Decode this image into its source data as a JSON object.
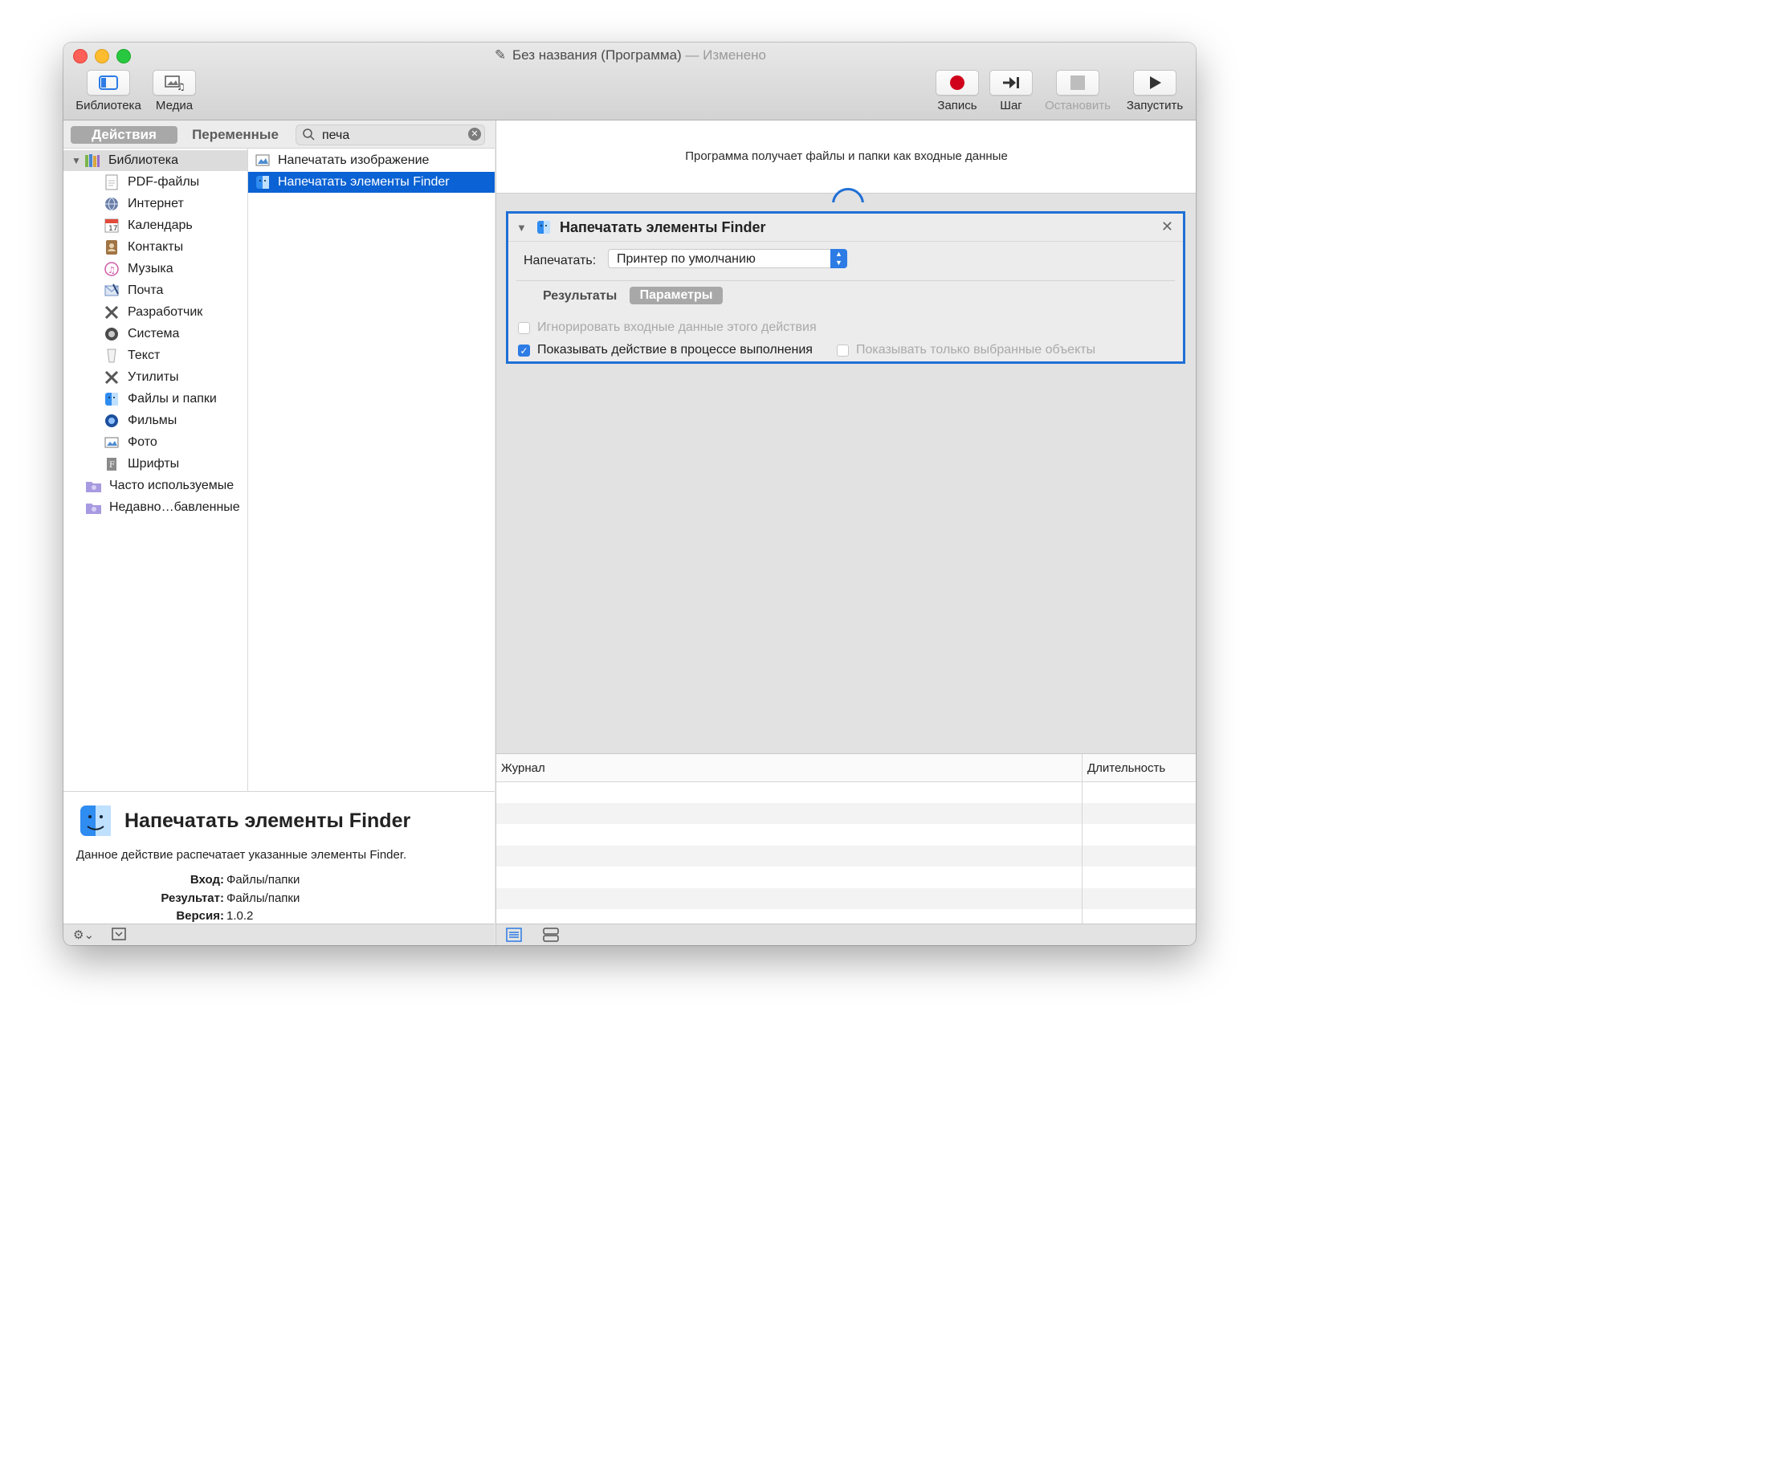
{
  "window": {
    "title": "Без названия (Программа)",
    "title_separator": " — ",
    "edited": "Изменено"
  },
  "toolbar": {
    "library": "Библиотека",
    "media": "Медиа",
    "record": "Запись",
    "step": "Шаг",
    "stop": "Остановить",
    "run": "Запустить"
  },
  "tabs": {
    "actions": "Действия",
    "variables": "Переменные"
  },
  "search": {
    "value": "печа"
  },
  "library": {
    "root": "Библиотека",
    "items": [
      {
        "label": "PDF-файлы",
        "icon": "pdf-icon"
      },
      {
        "label": "Интернет",
        "icon": "globe-icon"
      },
      {
        "label": "Календарь",
        "icon": "calendar-icon"
      },
      {
        "label": "Контакты",
        "icon": "contacts-icon"
      },
      {
        "label": "Музыка",
        "icon": "music-icon"
      },
      {
        "label": "Почта",
        "icon": "mail-icon"
      },
      {
        "label": "Разработчик",
        "icon": "developer-icon"
      },
      {
        "label": "Система",
        "icon": "system-icon"
      },
      {
        "label": "Текст",
        "icon": "text-icon"
      },
      {
        "label": "Утилиты",
        "icon": "utilities-icon"
      },
      {
        "label": "Файлы и папки",
        "icon": "finder-icon"
      },
      {
        "label": "Фильмы",
        "icon": "movies-icon"
      },
      {
        "label": "Фото",
        "icon": "photo-icon"
      },
      {
        "label": "Шрифты",
        "icon": "fonts-icon"
      }
    ],
    "smart": [
      {
        "label": "Часто используемые",
        "icon": "smart-folder-icon"
      },
      {
        "label": "Недавно…бавленные",
        "icon": "smart-folder-icon"
      }
    ]
  },
  "actions": [
    {
      "label": "Напечатать изображение",
      "icon": "preview-icon"
    },
    {
      "label": "Напечатать элементы Finder",
      "icon": "finder-icon",
      "selected": true
    }
  ],
  "description": {
    "title": "Напечатать элементы Finder",
    "text": "Данное действие распечатает указанные элементы Finder.",
    "input_label": "Вход:",
    "input_value": "Файлы/папки",
    "result_label": "Результат:",
    "result_value": "Файлы/папки",
    "version_label": "Версия:",
    "version_value": "1.0.2"
  },
  "workflow": {
    "header": "Программа получает файлы и папки как входные данные",
    "card": {
      "title": "Напечатать элементы Finder",
      "print_label": "Напечатать:",
      "printer": "Принтер по умолчанию",
      "tab_results": "Результаты",
      "tab_options": "Параметры",
      "opt_ignore": "Игнорировать входные данные этого действия",
      "opt_show": "Показывать действие в процессе выполнения",
      "opt_selected": "Показывать только выбранные объекты",
      "opt_show_checked": true
    }
  },
  "log": {
    "col_log": "Журнал",
    "col_duration": "Длительность"
  },
  "colors": {
    "accent": "#0a62d4",
    "record": "#d0021b"
  }
}
